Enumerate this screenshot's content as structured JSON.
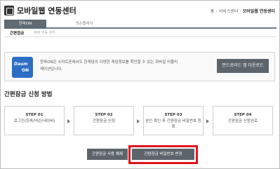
{
  "header": {
    "title": "모바일웹 연동센터",
    "breadcrumb": [
      "홈",
      "서비스센터",
      "모바일웹 연동센터"
    ]
  },
  "tabs": [
    {
      "label": "한파ON",
      "active": true
    },
    {
      "label": "넷손플레이",
      "active": false
    }
  ],
  "subbar": {
    "active": "간편접금",
    "hint": "계정 연동 관리"
  },
  "info": {
    "app_icon": {
      "line1": "Daum",
      "line2": "ON"
    },
    "text": "한파ON은 스마트폰에서도 한게임의 다양한 게임정보를 확인할 수 있는 모바일 어플리케이션입니다.",
    "download_label": "안드로이드 앱 다운로드"
  },
  "section_title": "간편잠금 신청 방법",
  "steps": [
    {
      "num": "STEP 01",
      "desc": "로그인(한파/넥슨/네이버)"
    },
    {
      "num": "STEP 02",
      "desc": "간편잠금 신청"
    },
    {
      "num": "STEP 03",
      "desc": "본인 확인 후 간편잠금 비밀번호 등록"
    },
    {
      "num": "STEP 04",
      "desc": "간편잠금 신청완료"
    }
  ],
  "buttons": {
    "cancel": "간편잠금 사용 해제",
    "change": "간편잠금 비밀번호 변경"
  },
  "colors": {
    "accent_dark": "#5d646b",
    "highlight": "#e2141d",
    "app_icon": "#2d6fc5"
  }
}
